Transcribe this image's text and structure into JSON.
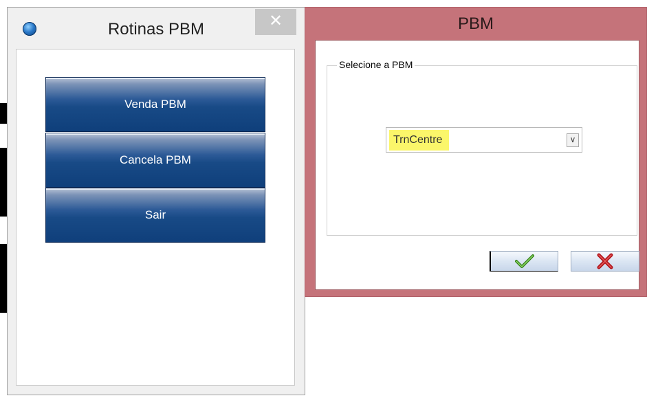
{
  "left_window": {
    "title": "Rotinas PBM",
    "close_glyph": "✕",
    "buttons": [
      "Venda PBM",
      "Cancela PBM",
      "Sair"
    ]
  },
  "right_window": {
    "title": "PBM",
    "group_label": "Selecione a PBM",
    "combo": {
      "selected": "TrnCentre",
      "arrow_glyph": "∨"
    },
    "ok_icon": "checkmark-icon",
    "cancel_icon": "x-icon"
  },
  "colors": {
    "button_blue": "#184a86",
    "right_frame": "#c5737a",
    "highlight": "#fbf66a"
  }
}
